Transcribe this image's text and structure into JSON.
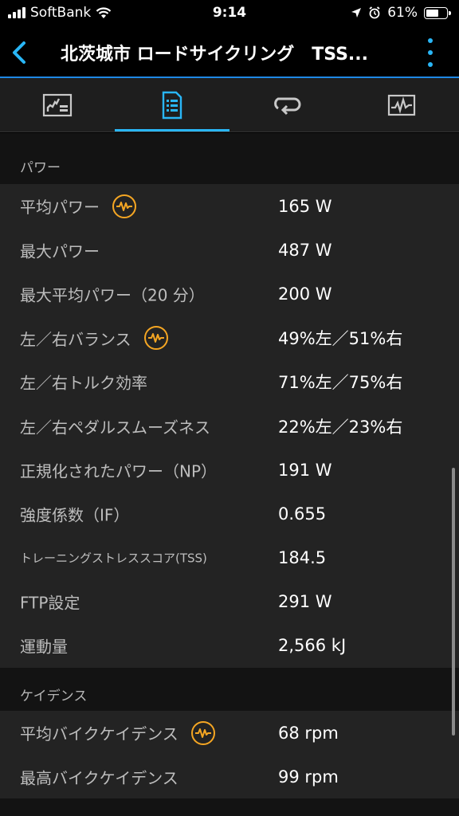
{
  "status_bar": {
    "carrier": "SoftBank",
    "time": "9:14",
    "battery_percent": "61%",
    "battery_level": 0.61
  },
  "header": {
    "title": "北茨城市 ロードサイクリング　TSS..."
  },
  "tabs": [
    {
      "icon": "chart-icon",
      "active": false
    },
    {
      "icon": "document-list-icon",
      "active": true
    },
    {
      "icon": "loop-arrow-icon",
      "active": false
    },
    {
      "icon": "graph-icon",
      "active": false
    }
  ],
  "sections": {
    "power": {
      "title": "パワー",
      "rows": [
        {
          "label": "平均パワー",
          "value": "165 W",
          "badge": true
        },
        {
          "label": "最大パワー",
          "value": "487 W"
        },
        {
          "label": "最大平均パワー（20 分）",
          "value": "200 W"
        },
        {
          "label": "左／右バランス",
          "value": "49%左／51%右",
          "badge": true
        },
        {
          "label": "左／右トルク効率",
          "value": "71%左／75%右"
        },
        {
          "label": "左／右ペダルスムーズネス",
          "value": "22%左／23%右"
        },
        {
          "label": "正規化されたパワー（NP）",
          "value": "191 W"
        },
        {
          "label": "強度係数（IF）",
          "value": "0.655"
        },
        {
          "label": "トレーニングストレススコア(TSS)",
          "value": "184.5"
        },
        {
          "label": "FTP設定",
          "value": "291 W"
        },
        {
          "label": "運動量",
          "value": "2,566 kJ"
        }
      ]
    },
    "cadence": {
      "title": "ケイデンス",
      "rows": [
        {
          "label": "平均バイクケイデンス",
          "value": "68 rpm",
          "badge": true
        },
        {
          "label": "最高バイクケイデンス",
          "value": "99 rpm"
        }
      ]
    }
  },
  "colors": {
    "accent_blue": "#29b6f6",
    "badge_orange": "#f5a623",
    "row_bg": "#232323",
    "section_bg": "#131313"
  }
}
